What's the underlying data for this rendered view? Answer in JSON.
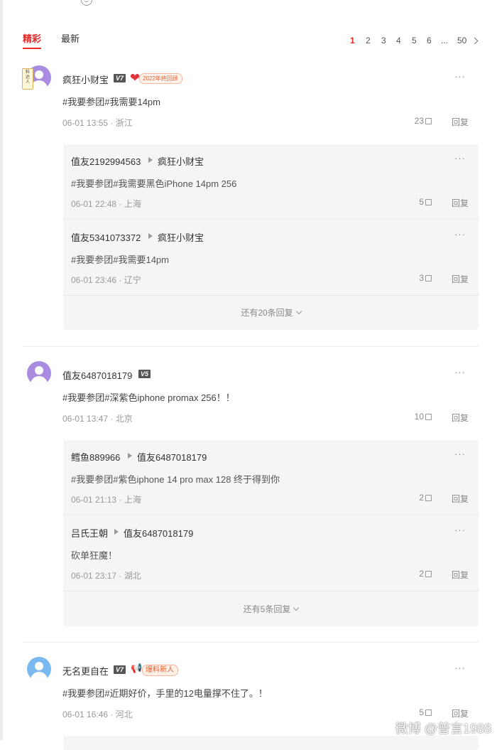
{
  "tabs": [
    "精彩",
    "最新"
  ],
  "pagination": {
    "pages": [
      "1",
      "2",
      "3",
      "4",
      "5",
      "6",
      "...",
      "50"
    ],
    "current": "1"
  },
  "comments": [
    {
      "user": "疯狂小财宝",
      "level": "V7",
      "badge": "2022年終回顾",
      "text": "#我要参团#我需要14pm",
      "time": "06-01 13:55",
      "location": "浙江",
      "likes": "23",
      "reply_label": "回复",
      "more": "···",
      "replies": [
        {
          "user": "值友2192994563",
          "target": "疯狂小财宝",
          "text": "#我要参团#我需要黑色iPhone 14pm 256",
          "time": "06-01 22:48",
          "location": "上海",
          "likes": "5",
          "reply_label": "回复"
        },
        {
          "user": "值友5341073372",
          "target": "疯狂小财宝",
          "text": "#我要参团#我需要14pm",
          "time": "06-01 23:46",
          "location": "辽宁",
          "likes": "3",
          "reply_label": "回复"
        }
      ],
      "show_more": "还有20条回复"
    },
    {
      "user": "值友6487018179",
      "level": "V5",
      "text": "#我要参团#深紫色iphone promax 256！！",
      "time": "06-01 13:47",
      "location": "北京",
      "likes": "10",
      "reply_label": "回复",
      "more": "···",
      "replies": [
        {
          "user": "鳕鱼889966",
          "target": "值友6487018179",
          "text": "#我要参团#紫色iphone 14 pro max 128 终于得到你",
          "time": "06-01 21:13",
          "location": "上海",
          "likes": "2",
          "reply_label": "回复"
        },
        {
          "user": "吕氏王朝",
          "target": "值友6487018179",
          "text": "砍单狂魔！",
          "time": "06-01 23:17",
          "location": "湖北",
          "likes": "2",
          "reply_label": "回复"
        }
      ],
      "show_more": "还有5条回复"
    },
    {
      "user": "无名更自在",
      "level": "V7",
      "badge": "爆料新人",
      "text": "#我要参团#近期好价，手里的12电量撑不住了。！",
      "time": "06-01 16:46",
      "location": "河北",
      "likes": "5",
      "reply_label": "回复",
      "more": "···"
    }
  ],
  "watermark": "微博 @普言1988"
}
